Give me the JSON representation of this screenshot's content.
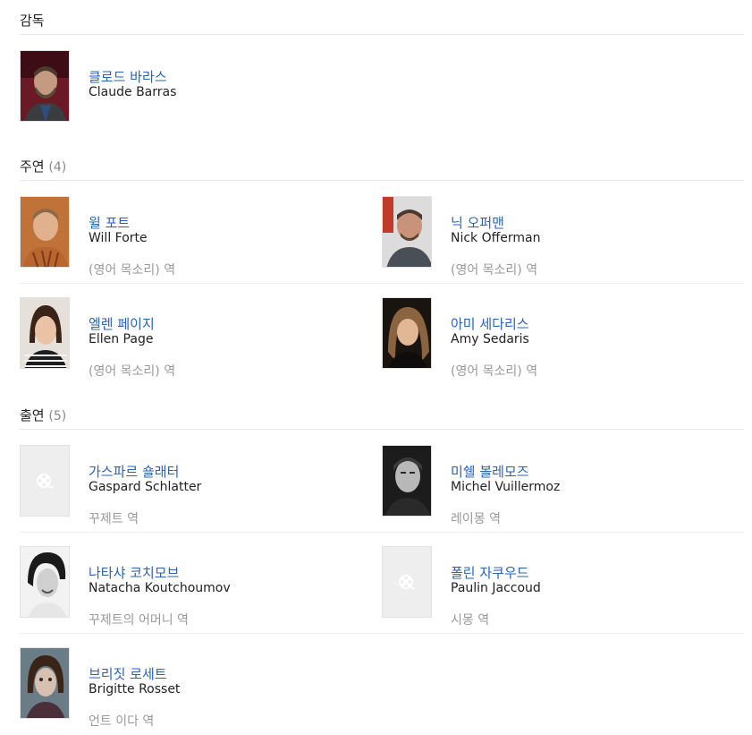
{
  "director_section": {
    "title": "감독",
    "person": {
      "name_ko": "클로드 바라스",
      "name_en": "Claude Barras"
    }
  },
  "lead_section": {
    "title": "주연",
    "count": "(4)",
    "people": [
      {
        "name_ko": "윌 포트",
        "name_en": "Will Forte",
        "role": "(영어 목소리) 역"
      },
      {
        "name_ko": "닉 오퍼맨",
        "name_en": "Nick Offerman",
        "role": "(영어 목소리) 역"
      },
      {
        "name_ko": "엘렌 페이지",
        "name_en": "Ellen Page",
        "role": "(영어 목소리) 역"
      },
      {
        "name_ko": "아미 세다리스",
        "name_en": "Amy Sedaris",
        "role": "(영어 목소리) 역"
      }
    ]
  },
  "supporting_section": {
    "title": "출연",
    "count": "(5)",
    "people": [
      {
        "name_ko": "가스파르 숄래터",
        "name_en": "Gaspard Schlatter",
        "role": "꾸제트 역"
      },
      {
        "name_ko": "미쉘 볼레모즈",
        "name_en": "Michel Vuillermoz",
        "role": "레이몽 역"
      },
      {
        "name_ko": "나타샤 코치모브",
        "name_en": "Natacha Koutchoumov",
        "role": "꾸제트의 어머니 역"
      },
      {
        "name_ko": "폴린 자쿠우드",
        "name_en": "Paulin Jaccoud",
        "role": "시몽 역"
      },
      {
        "name_ko": "브리짓 로세트",
        "name_en": "Brigitte Rosset",
        "role": "언트 이다 역"
      }
    ]
  },
  "colors": {
    "link": "#2a63b8",
    "muted": "#999999",
    "divider": "#e9e9e9",
    "placeholder": "#eeeeee"
  },
  "icons": {
    "placeholder_photo": "film-reel-icon"
  }
}
